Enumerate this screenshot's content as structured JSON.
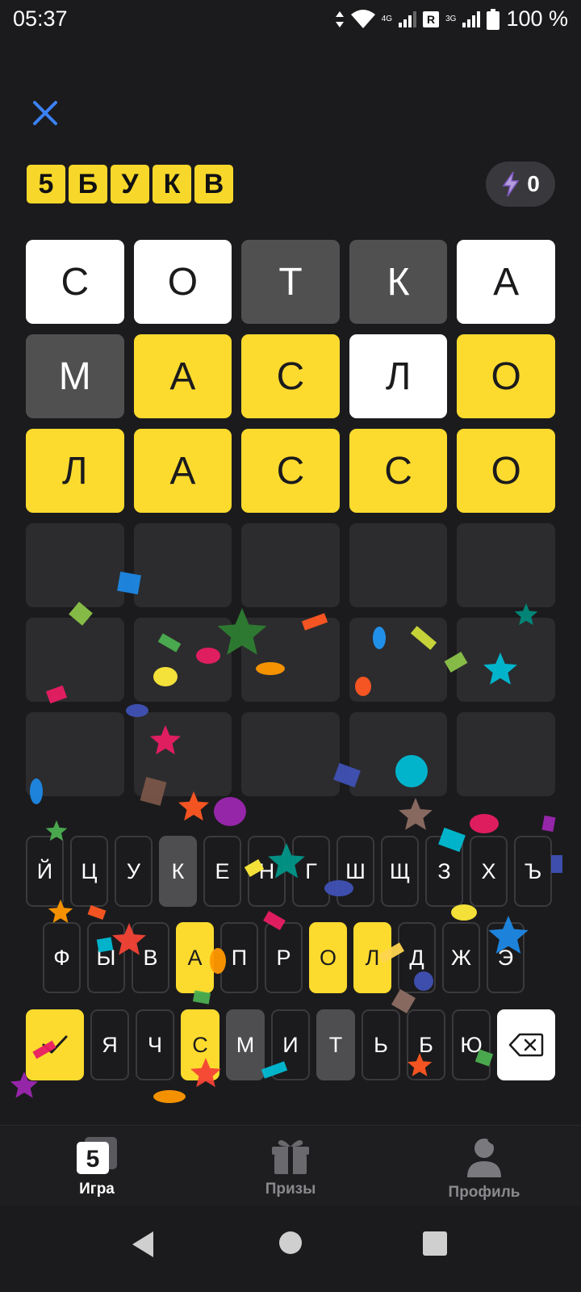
{
  "status_bar": {
    "time": "05:37",
    "net1": "4G",
    "roaming": "R",
    "net2": "3G",
    "battery": "100 %"
  },
  "logo": [
    "5",
    "Б",
    "У",
    "К",
    "В"
  ],
  "energy": {
    "count": "0",
    "icon": "lightning-icon"
  },
  "grid": [
    [
      {
        "letter": "С",
        "state": "white"
      },
      {
        "letter": "О",
        "state": "white"
      },
      {
        "letter": "Т",
        "state": "gray"
      },
      {
        "letter": "К",
        "state": "gray"
      },
      {
        "letter": "А",
        "state": "white"
      }
    ],
    [
      {
        "letter": "М",
        "state": "gray"
      },
      {
        "letter": "А",
        "state": "yellow"
      },
      {
        "letter": "С",
        "state": "yellow"
      },
      {
        "letter": "Л",
        "state": "white"
      },
      {
        "letter": "О",
        "state": "yellow"
      }
    ],
    [
      {
        "letter": "Л",
        "state": "yellow"
      },
      {
        "letter": "А",
        "state": "yellow"
      },
      {
        "letter": "С",
        "state": "yellow"
      },
      {
        "letter": "С",
        "state": "yellow"
      },
      {
        "letter": "О",
        "state": "yellow"
      }
    ],
    [
      {
        "letter": "",
        "state": "empty"
      },
      {
        "letter": "",
        "state": "empty"
      },
      {
        "letter": "",
        "state": "empty"
      },
      {
        "letter": "",
        "state": "empty"
      },
      {
        "letter": "",
        "state": "empty"
      }
    ],
    [
      {
        "letter": "",
        "state": "empty"
      },
      {
        "letter": "",
        "state": "empty"
      },
      {
        "letter": "",
        "state": "empty"
      },
      {
        "letter": "",
        "state": "empty"
      },
      {
        "letter": "",
        "state": "empty"
      }
    ],
    [
      {
        "letter": "",
        "state": "empty"
      },
      {
        "letter": "",
        "state": "empty"
      },
      {
        "letter": "",
        "state": "empty"
      },
      {
        "letter": "",
        "state": "empty"
      },
      {
        "letter": "",
        "state": "empty"
      }
    ]
  ],
  "keyboard": {
    "row1": [
      {
        "k": "Й",
        "s": "default"
      },
      {
        "k": "Ц",
        "s": "default"
      },
      {
        "k": "У",
        "s": "default"
      },
      {
        "k": "К",
        "s": "gray"
      },
      {
        "k": "Е",
        "s": "default"
      },
      {
        "k": "Н",
        "s": "default"
      },
      {
        "k": "Г",
        "s": "default"
      },
      {
        "k": "Ш",
        "s": "default"
      },
      {
        "k": "Щ",
        "s": "default"
      },
      {
        "k": "З",
        "s": "default"
      },
      {
        "k": "Х",
        "s": "default"
      },
      {
        "k": "Ъ",
        "s": "default"
      }
    ],
    "row2": [
      {
        "k": "Ф",
        "s": "default"
      },
      {
        "k": "Ы",
        "s": "default"
      },
      {
        "k": "В",
        "s": "default"
      },
      {
        "k": "А",
        "s": "yellow"
      },
      {
        "k": "П",
        "s": "default"
      },
      {
        "k": "Р",
        "s": "default"
      },
      {
        "k": "О",
        "s": "yellow"
      },
      {
        "k": "Л",
        "s": "yellow"
      },
      {
        "k": "Д",
        "s": "default"
      },
      {
        "k": "Ж",
        "s": "default"
      },
      {
        "k": "Э",
        "s": "default"
      }
    ],
    "row3": [
      {
        "k": "Я",
        "s": "default"
      },
      {
        "k": "Ч",
        "s": "default"
      },
      {
        "k": "С",
        "s": "yellow"
      },
      {
        "k": "М",
        "s": "gray"
      },
      {
        "k": "И",
        "s": "default"
      },
      {
        "k": "Т",
        "s": "gray"
      },
      {
        "k": "Ь",
        "s": "default"
      },
      {
        "k": "Б",
        "s": "default"
      },
      {
        "k": "Ю",
        "s": "default"
      }
    ],
    "enter_icon": "check-icon",
    "backspace_icon": "backspace-icon"
  },
  "nav": {
    "game": "Игра",
    "game_icon_text": "5",
    "prizes": "Призы",
    "profile": "Профиль"
  },
  "colors": {
    "background": "#1b1b1d",
    "accent_yellow": "#fddb2e",
    "tile_gray": "#505050",
    "tile_white": "#ffffff",
    "tile_empty": "#2c2c2e",
    "close_blue": "#3b82f6"
  }
}
